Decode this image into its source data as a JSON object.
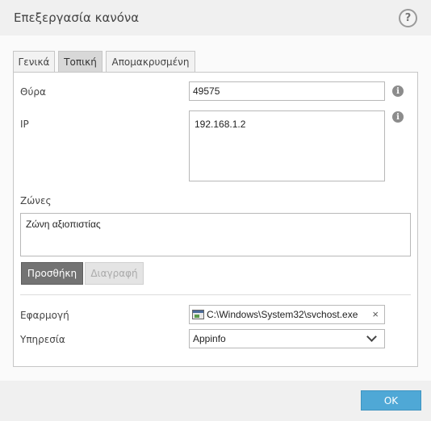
{
  "window": {
    "title": "Επεξεργασία κανόνα",
    "help_label": "?"
  },
  "tabs": [
    {
      "label": "Γενικά",
      "active": false
    },
    {
      "label": "Τοπική",
      "active": true
    },
    {
      "label": "Απομακρυσμένη",
      "active": false
    }
  ],
  "form": {
    "port_label": "Θύρα",
    "port_value": "49575",
    "ip_label": "IP",
    "ip_value": "192.168.1.2",
    "zones_label": "Ζώνες",
    "zones_value": "Ζώνη αξιοπιστίας",
    "add_button": "Προσθήκη",
    "delete_button": "Διαγραφή",
    "application_label": "Εφαρμογή",
    "application_value": "C:\\Windows\\System32\\svchost.exe",
    "clear_symbol": "×",
    "service_label": "Υπηρεσία",
    "service_value": "Appinfo",
    "info_symbol": "i"
  },
  "footer": {
    "ok_label": "OK"
  },
  "colors": {
    "ok_button": "#4fa8d6",
    "add_button": "#737373",
    "active_tab": "#d8d8d8"
  },
  "icons": [
    "help-icon",
    "info-icon",
    "app-window-icon",
    "clear-icon",
    "chevron-down-icon"
  ]
}
